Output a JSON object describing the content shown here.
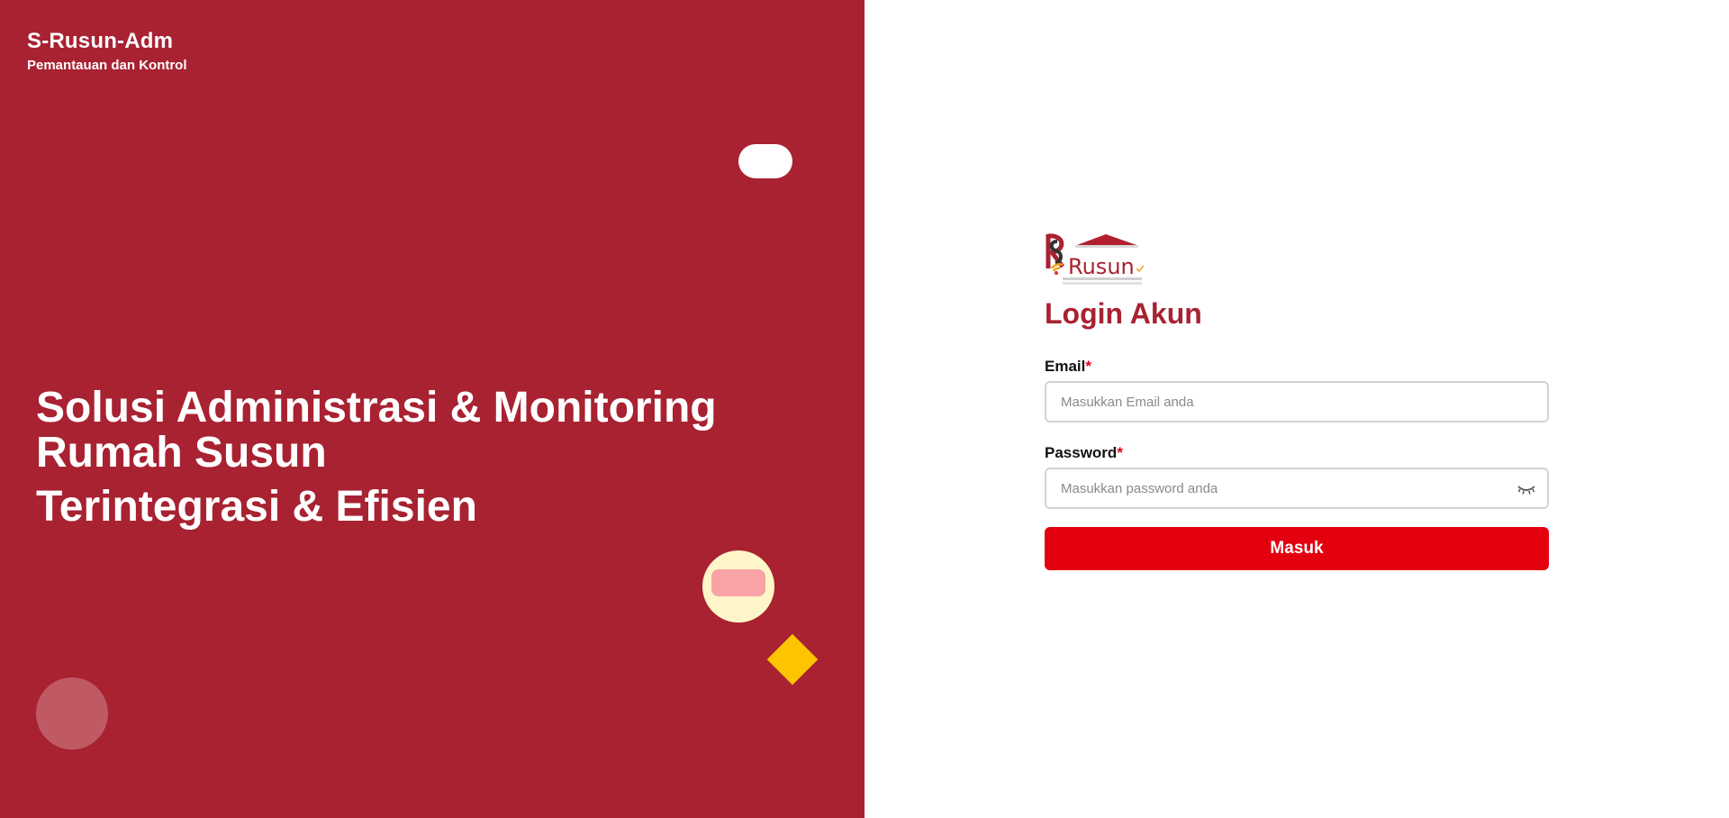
{
  "brand": {
    "title": "S-Rusun-Adm",
    "subtitle": "Pemantauan dan Kontrol"
  },
  "hero": {
    "line1": "Solusi Administrasi & Monitoring Rumah Susun",
    "line2": "Terintegrasi & Efisien"
  },
  "logo": {
    "text": "Rusun",
    "icon": "house-roof-logo"
  },
  "login": {
    "title": "Login Akun",
    "email_label": "Email",
    "email_placeholder": "Masukkan Email anda",
    "password_label": "Password",
    "password_placeholder": "Masukkan password anda",
    "required_marker": "*",
    "submit_label": "Masuk",
    "password_toggle_icon": "eye-closed-icon"
  },
  "colors": {
    "left_panel": "#a82232",
    "accent": "#a82232",
    "button": "#e3000f",
    "required": "#e0001b",
    "deco_yellow": "#fdc500",
    "deco_cream": "#fef6c8",
    "deco_pink": "#f8a3a6"
  }
}
